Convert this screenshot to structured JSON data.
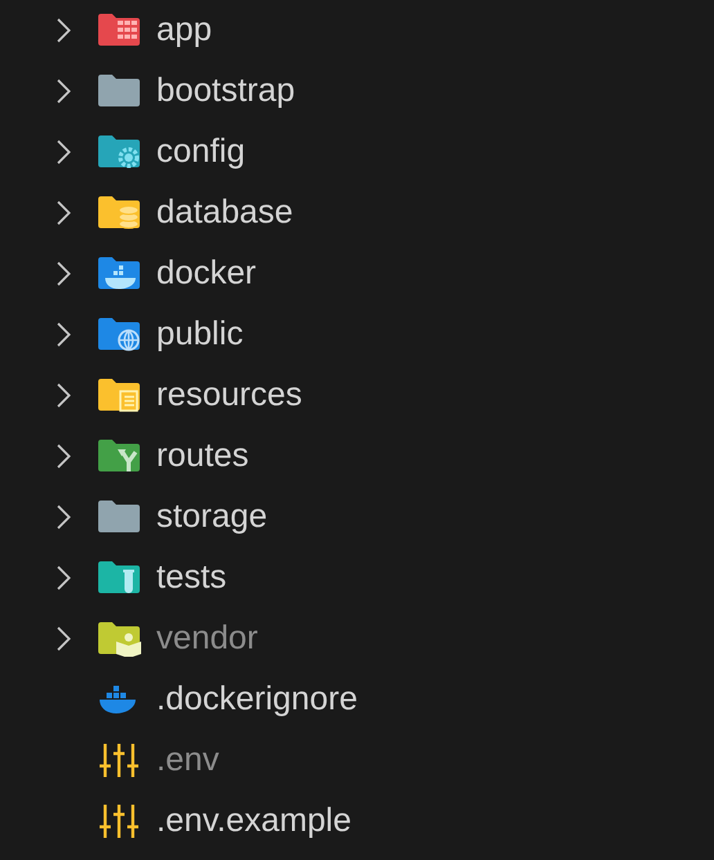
{
  "tree": [
    {
      "label": "app",
      "kind": "folder",
      "expanded": false,
      "dimmed": false,
      "color": "#e5484d"
    },
    {
      "label": "bootstrap",
      "kind": "folder",
      "expanded": false,
      "dimmed": false,
      "color": "#90a4ae"
    },
    {
      "label": "config",
      "kind": "folder",
      "expanded": false,
      "dimmed": false,
      "color": "#26a5b8"
    },
    {
      "label": "database",
      "kind": "folder",
      "expanded": false,
      "dimmed": false,
      "color": "#fbc02d"
    },
    {
      "label": "docker",
      "kind": "folder",
      "expanded": false,
      "dimmed": false,
      "color": "#1e88e5"
    },
    {
      "label": "public",
      "kind": "folder",
      "expanded": false,
      "dimmed": false,
      "color": "#1e88e5"
    },
    {
      "label": "resources",
      "kind": "folder",
      "expanded": false,
      "dimmed": false,
      "color": "#fbc02d"
    },
    {
      "label": "routes",
      "kind": "folder",
      "expanded": false,
      "dimmed": false,
      "color": "#43a047"
    },
    {
      "label": "storage",
      "kind": "folder",
      "expanded": false,
      "dimmed": false,
      "color": "#90a4ae"
    },
    {
      "label": "tests",
      "kind": "folder",
      "expanded": false,
      "dimmed": false,
      "color": "#1cb5a5"
    },
    {
      "label": "vendor",
      "kind": "folder",
      "expanded": false,
      "dimmed": true,
      "color": "#c0ca33"
    },
    {
      "label": ".dockerignore",
      "kind": "file",
      "dimmed": false,
      "color": "#1e88e5"
    },
    {
      "label": ".env",
      "kind": "file",
      "dimmed": true,
      "color": "#fbc02d"
    },
    {
      "label": ".env.example",
      "kind": "file",
      "dimmed": false,
      "color": "#fbc02d"
    }
  ]
}
